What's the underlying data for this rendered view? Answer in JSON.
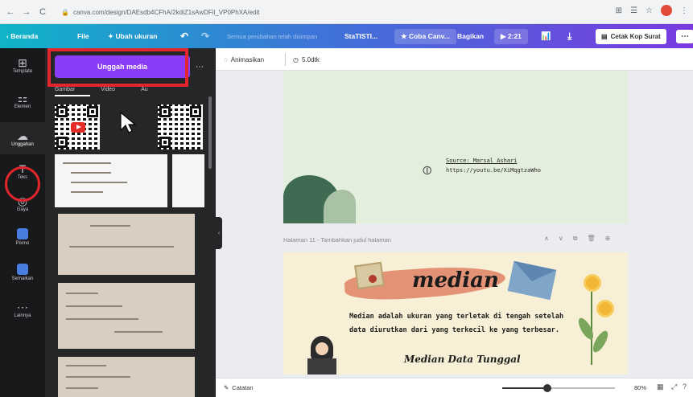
{
  "browser": {
    "url": "canva.com/design/DAEsdb4CFhA/2kdiZ1sAwDFil_VP0PhXA/edit",
    "back": "←",
    "forward": "→",
    "reload": "C",
    "lock": "🔒",
    "right_icons": [
      "⊞",
      "☰",
      "☆",
      "⋮"
    ]
  },
  "topbar": {
    "home": "‹ Beranda",
    "file": "File",
    "resize": "✦ Ubah ukuran",
    "undo": "↶",
    "redo": "↷",
    "saved_status": "Semua perubahan telah disimpan",
    "doc_title": "StaTISTI...",
    "try_canva": "★ Coba Canv...",
    "share": "Bagikan",
    "play_time": "▶ 2:21",
    "chart_icon": "📊",
    "download_icon": "⤓",
    "print_kop": "Cetak Kop Surat",
    "more": "⋯"
  },
  "rail": [
    {
      "icon": "⊞",
      "label": "Template"
    },
    {
      "icon": "⚏",
      "label": "Elemen"
    },
    {
      "icon": "☁",
      "label": "Unggahan"
    },
    {
      "icon": "T",
      "label": "Teks"
    },
    {
      "icon": "◎",
      "label": "Gaya"
    },
    {
      "icon": "",
      "label": "Pixmo"
    },
    {
      "icon": "",
      "label": "Semaikan"
    },
    {
      "icon": "⋯",
      "label": "Lainnya"
    }
  ],
  "panel": {
    "upload_button": "Unggah media",
    "more": "⋯",
    "tabs": [
      "Gambar",
      "Video",
      "Au"
    ]
  },
  "toolbar": {
    "animate": "Animasikan",
    "duration": "5.0dtk"
  },
  "page10": {
    "source_label": "Source: Marsal Ashari",
    "source_url": "https://youtu.be/XiMqgtzaWho"
  },
  "page11": {
    "label": "Halaman 11 - Tambahkan judul halaman",
    "actions": [
      "∧",
      "∨",
      "⧉",
      "🗑",
      "⊕"
    ],
    "title": "median",
    "description": "Median adalah ukuran yang terletak di tengah setelah data diurutkan dari yang terkecil ke yang terbesar.",
    "subtitle": "Median Data Tunggal"
  },
  "bottombar": {
    "notes": "Catatan",
    "zoom": "80%",
    "zoom_fraction": 0.8
  }
}
